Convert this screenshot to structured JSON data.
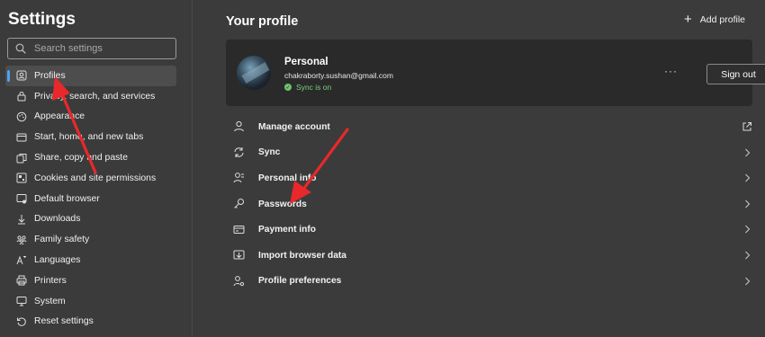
{
  "sidebar": {
    "title": "Settings",
    "search_placeholder": "Search settings",
    "items": [
      {
        "label": "Profiles",
        "icon": "profiles-icon",
        "active": true
      },
      {
        "label": "Privacy, search, and services",
        "icon": "lock-icon"
      },
      {
        "label": "Appearance",
        "icon": "appearance-icon"
      },
      {
        "label": "Start, home, and new tabs",
        "icon": "home-tabs-icon"
      },
      {
        "label": "Share, copy and paste",
        "icon": "share-icon"
      },
      {
        "label": "Cookies and site permissions",
        "icon": "cookies-icon"
      },
      {
        "label": "Default browser",
        "icon": "browser-icon"
      },
      {
        "label": "Downloads",
        "icon": "download-icon"
      },
      {
        "label": "Family safety",
        "icon": "family-icon"
      },
      {
        "label": "Languages",
        "icon": "languages-icon"
      },
      {
        "label": "Printers",
        "icon": "printer-icon"
      },
      {
        "label": "System",
        "icon": "system-icon"
      },
      {
        "label": "Reset settings",
        "icon": "reset-icon"
      }
    ]
  },
  "main": {
    "title": "Your profile",
    "add_profile": "Add profile",
    "profile": {
      "name": "Personal",
      "email": "chakraborty.sushan@gmail.com",
      "sync_status": "Sync is on",
      "more": "···",
      "signout": "Sign out"
    },
    "rows": [
      {
        "label": "Manage account",
        "icon": "person-icon",
        "tail": "external-link-icon"
      },
      {
        "label": "Sync",
        "icon": "sync-icon",
        "tail": "chevron-right-icon"
      },
      {
        "label": "Personal info",
        "icon": "personal-info-icon",
        "tail": "chevron-right-icon"
      },
      {
        "label": "Passwords",
        "icon": "key-icon",
        "tail": "chevron-right-icon"
      },
      {
        "label": "Payment info",
        "icon": "card-icon",
        "tail": "chevron-right-icon"
      },
      {
        "label": "Import browser data",
        "icon": "import-icon",
        "tail": "chevron-right-icon"
      },
      {
        "label": "Profile preferences",
        "icon": "profile-prefs-icon",
        "tail": "chevron-right-icon"
      }
    ]
  },
  "colors": {
    "accent": "#4ea1f3",
    "annotation": "#e8282b",
    "sync": "#6cc46c"
  }
}
